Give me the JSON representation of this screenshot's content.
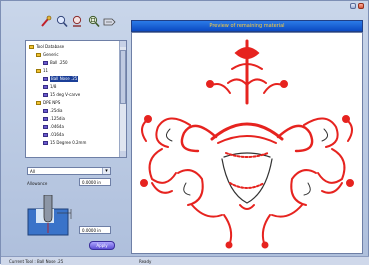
{
  "window": {
    "icons": [
      "minimize-icon",
      "close-icon"
    ]
  },
  "toolbar": {
    "icons": [
      "probe-icon",
      "zoom-icon",
      "stock-icon",
      "zoom-fit-icon",
      "cutter-icon"
    ]
  },
  "tree": {
    "items": [
      {
        "label": "Tool Database",
        "level": 0,
        "kind": "folder"
      },
      {
        "label": "Generic",
        "level": 1,
        "kind": "folder"
      },
      {
        "label": "Ball .250",
        "level": 2,
        "kind": "tool"
      },
      {
        "label": "11",
        "level": 1,
        "kind": "folder"
      },
      {
        "label": "Ball Nose .25",
        "level": 2,
        "kind": "tool",
        "selected": true
      },
      {
        "label": "1/8",
        "level": 2,
        "kind": "tool"
      },
      {
        "label": "15 deg V-carve",
        "level": 2,
        "kind": "tool"
      },
      {
        "label": "DPE NPS",
        "level": 1,
        "kind": "folder"
      },
      {
        "label": ".25dia",
        "level": 2,
        "kind": "tool"
      },
      {
        "label": ".125dia",
        "level": 2,
        "kind": "tool"
      },
      {
        "label": ".0464a",
        "level": 2,
        "kind": "tool"
      },
      {
        "label": ".0164a",
        "level": 2,
        "kind": "tool"
      },
      {
        "label": "15 Degree 0.2mm",
        "level": 2,
        "kind": "tool"
      }
    ]
  },
  "controls": {
    "combo_value": "All",
    "allowance_label": "Allowance",
    "allowance_value": "0.0000 in",
    "dimension_value": "0.0000 in",
    "apply_label": "Apply"
  },
  "preview": {
    "title": "Preview of remaining material",
    "accent_color": "#e6231f",
    "outline_color": "#333333"
  },
  "status": {
    "tool": "Current Tool :  Ball Nose .25",
    "state": "Ready"
  }
}
